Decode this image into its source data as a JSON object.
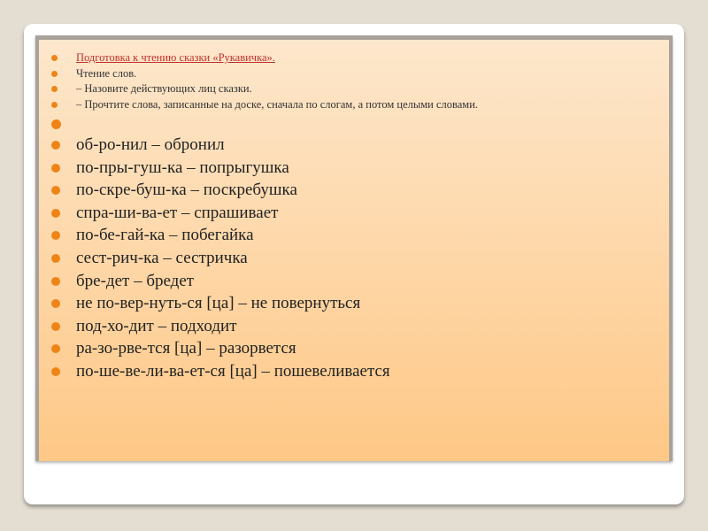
{
  "slide": {
    "title": " Подготовка к чтению сказки «Рукавичка».",
    "intro": [
      "Чтение слов.",
      "– Назовите действующих лиц сказки.",
      "– Прочтите слова, записанные на доске, сначала по слогам, а потом целыми словами."
    ],
    "words": [
      "об-ро-нил – обронил",
      "по-пры-гуш-ка – попрыгушка",
      "по-скре-буш-ка – поскребушка",
      "спра-ши-ва-ет – спрашивает",
      "по-бе-гай-ка – побегайка",
      "сест-рич-ка – сестричка",
      "бре-дет – бредет",
      "не по-вер-нуть-ся [ца] – не повернуться",
      "под-хо-дит – подходит",
      "ра-зо-рве-тся [ца] – разорвется",
      "по-ше-ве-ли-ва-ет-ся [ца] – пошевеливается"
    ]
  },
  "colors": {
    "accent": "#ee8416",
    "title": "#c0302a",
    "panel": "#fec886",
    "background": "#e3ddd2"
  }
}
